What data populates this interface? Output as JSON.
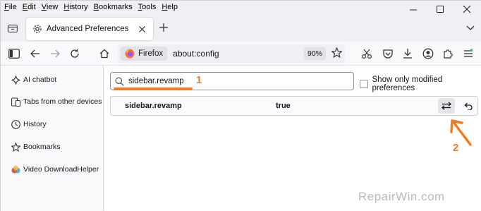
{
  "menu": [
    "File",
    "Edit",
    "View",
    "History",
    "Bookmarks",
    "Tools",
    "Help"
  ],
  "menu_underline": [
    "F",
    "E",
    "V",
    "H",
    "B",
    "T",
    "H"
  ],
  "menu_rest": [
    "ile",
    "dit",
    "iew",
    "istory",
    "ookmarks",
    "ools",
    "elp"
  ],
  "tab": {
    "title": "Advanced Preferences"
  },
  "urlbar": {
    "identity_label": "Firefox",
    "url": "about:config",
    "zoom": "90%"
  },
  "sidebar": {
    "items": [
      {
        "label": "AI chatbot",
        "icon": "sparkle-icon"
      },
      {
        "label": "Tabs from other devices",
        "icon": "synced-tabs-icon"
      },
      {
        "label": "History",
        "icon": "clock-icon"
      },
      {
        "label": "Bookmarks",
        "icon": "star-icon"
      },
      {
        "label": "Video DownloadHelper",
        "icon": "extension-logo-icon"
      }
    ]
  },
  "config": {
    "search_value": "sidebar.revamp",
    "show_modified_label": "Show only modified preferences",
    "show_modified_checked": false,
    "pref": {
      "name": "sidebar.revamp",
      "value": "true"
    }
  },
  "annotations": {
    "step1": "1",
    "step2": "2"
  },
  "watermark": "RepairWin.com",
  "colors": {
    "accent": "#f27a21",
    "chrome_bg": "#f0f0f4",
    "toolbar_bg": "#f9f9fb"
  }
}
